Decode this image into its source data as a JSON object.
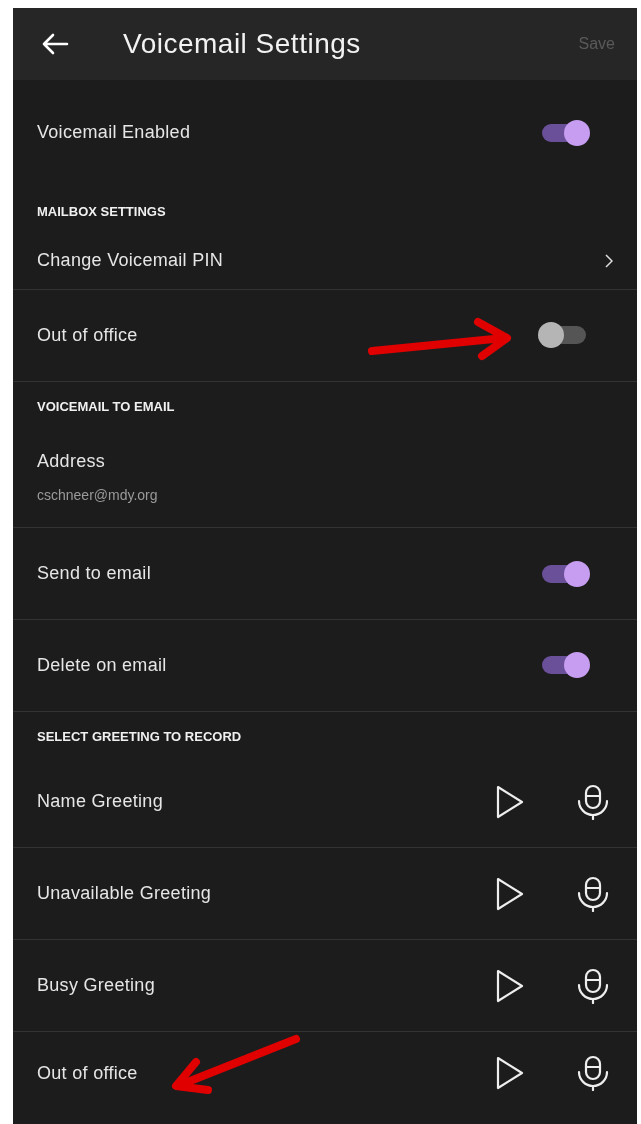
{
  "header": {
    "title": "Voicemail Settings",
    "save": "Save",
    "save_disabled": true
  },
  "items": [
    {
      "kind": "toggle",
      "label": "Voicemail Enabled",
      "on": true
    },
    {
      "kind": "section",
      "label": "MAILBOX SETTINGS"
    },
    {
      "kind": "link",
      "label": "Change Voicemail PIN"
    },
    {
      "kind": "toggle",
      "label": "Out of office",
      "on": false
    },
    {
      "kind": "section",
      "label": "VOICEMAIL TO EMAIL"
    },
    {
      "kind": "address",
      "label": "Address",
      "value": "cschneer@mdy.org"
    },
    {
      "kind": "toggle",
      "label": "Send to email",
      "on": true
    },
    {
      "kind": "toggle",
      "label": "Delete on email",
      "on": true
    },
    {
      "kind": "section",
      "label": "SELECT GREETING TO RECORD"
    },
    {
      "kind": "greeting",
      "label": "Name Greeting"
    },
    {
      "kind": "greeting",
      "label": "Unavailable Greeting"
    },
    {
      "kind": "greeting",
      "label": "Busy Greeting"
    },
    {
      "kind": "greeting",
      "label": "Out of office"
    }
  ]
}
